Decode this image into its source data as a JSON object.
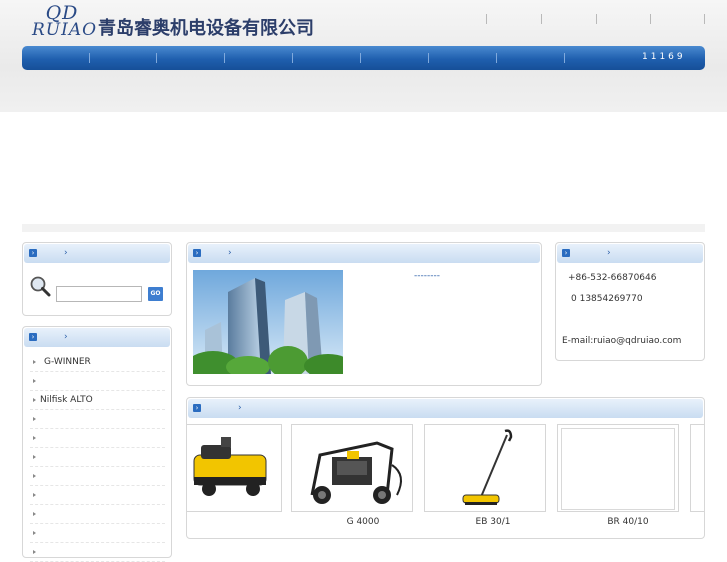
{
  "header": {
    "logo_top": "QD",
    "logo_bottom": "RUIAO",
    "company_name": "青岛睿奥机电设备有限公司"
  },
  "nav": {
    "phone": "11169"
  },
  "search": {
    "go_label": "GO"
  },
  "categories": {
    "items": [
      {
        "label": "G-WINNER"
      },
      {
        "label": ""
      },
      {
        "label": "Nilfisk ALTO"
      },
      {
        "label": ""
      },
      {
        "label": ""
      },
      {
        "label": ""
      },
      {
        "label": ""
      },
      {
        "label": ""
      },
      {
        "label": ""
      },
      {
        "label": ""
      },
      {
        "label": ""
      }
    ]
  },
  "about": {
    "more_link": "--------"
  },
  "contact": {
    "phone1": "+86-532-66870646",
    "phone2": "0 13854269770",
    "email": "E-mail:ruiao@qdruiao.com"
  },
  "products": {
    "items": [
      {
        "label": "",
        "icon": "ride-on-sweeper-image"
      },
      {
        "label": "G 4000",
        "icon": "pressure-washer-image"
      },
      {
        "label": "EB 30/1",
        "icon": "stick-sweeper-image"
      },
      {
        "label": "BR 40/10",
        "icon": "scrubber-image"
      }
    ]
  },
  "colors": {
    "nav_blue": "#1f5fae",
    "panel_head": "#c9dcf1",
    "accent": "#2a6cc0"
  }
}
